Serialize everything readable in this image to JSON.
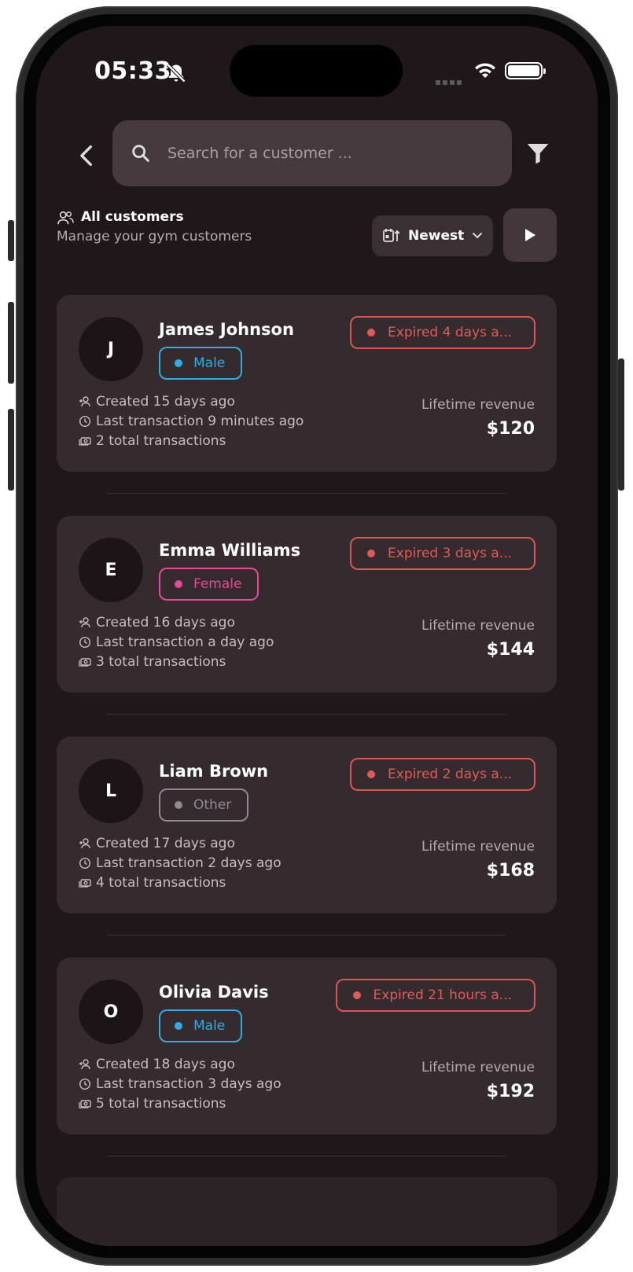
{
  "status_bar": {
    "time": "05:33"
  },
  "search": {
    "placeholder": "Search for a customer ..."
  },
  "section": {
    "title": "All customers",
    "subtitle": "Manage your gym customers"
  },
  "sort": {
    "selected": "Newest"
  },
  "revenue_label": "Lifetime revenue",
  "colors": {
    "male": "#29aee6",
    "female": "#e8479a",
    "other": "#8d8a96",
    "expired": "#e05a58"
  },
  "customers": [
    {
      "initial": "J",
      "name": "James Johnson",
      "gender": "Male",
      "status": "Expired 4 days a...",
      "created": "Created 15 days ago",
      "last_tx": "Last transaction 9 minutes ago",
      "total_tx": "2 total transactions",
      "revenue": "$120"
    },
    {
      "initial": "E",
      "name": "Emma Williams",
      "gender": "Female",
      "status": "Expired 3 days a...",
      "created": "Created 16 days ago",
      "last_tx": "Last transaction a day ago",
      "total_tx": "3 total transactions",
      "revenue": "$144"
    },
    {
      "initial": "L",
      "name": "Liam Brown",
      "gender": "Other",
      "status": "Expired 2 days a...",
      "created": "Created 17 days ago",
      "last_tx": "Last transaction 2 days ago",
      "total_tx": "4 total transactions",
      "revenue": "$168"
    },
    {
      "initial": "O",
      "name": "Olivia Davis",
      "gender": "Male",
      "status": "Expired 21 hours a...",
      "created": "Created 18 days ago",
      "last_tx": "Last transaction 3 days ago",
      "total_tx": "5 total transactions",
      "revenue": "$192"
    }
  ]
}
